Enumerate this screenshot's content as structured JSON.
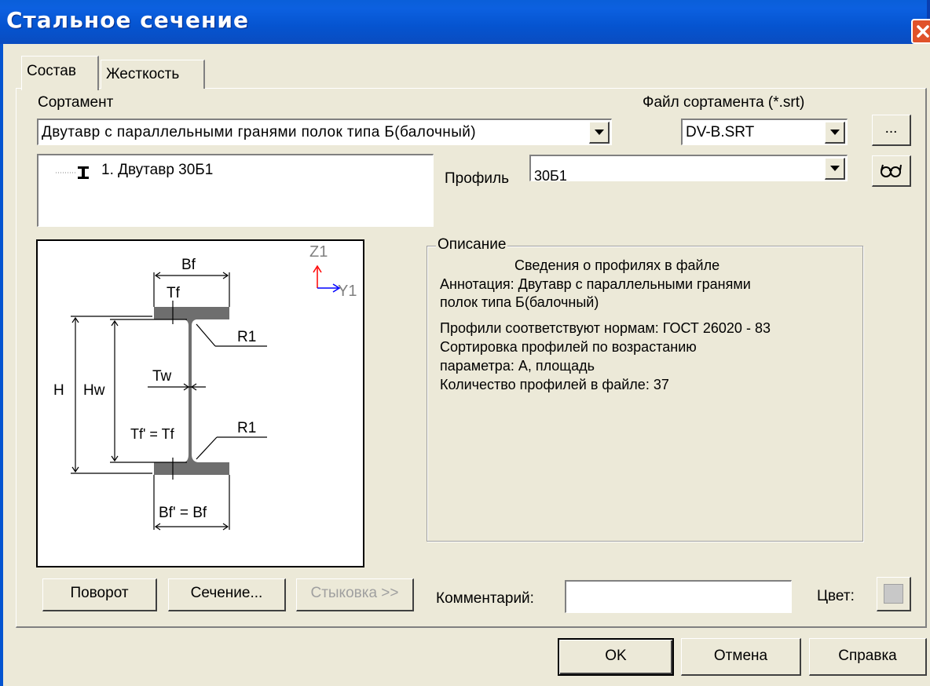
{
  "window": {
    "title": "Стальное сечение"
  },
  "tabs": [
    {
      "label": "Состав",
      "active": true
    },
    {
      "label": "Жесткость",
      "active": false
    }
  ],
  "assortment": {
    "label": "Сортамент",
    "value": "Двутавр с параллельными гранями полок типа Б(балочный)"
  },
  "assortment_file": {
    "label": "Файл сортамента (*.srt)",
    "value": "DV-B.SRT",
    "browse_label": "..."
  },
  "tree": {
    "items": [
      {
        "label": "1. Двутавр 30Б1",
        "icon": "i-beam-icon"
      }
    ]
  },
  "profile": {
    "label": "Профиль",
    "value": "30Б1"
  },
  "diagram": {
    "axis_z": "Z1",
    "axis_y": "Y1",
    "labels": {
      "bf": "Bf",
      "tf": "Tf",
      "r1_top": "R1",
      "h": "H",
      "hw": "Hw",
      "tw": "Tw",
      "tf2": "Tf' = Tf",
      "r1_bottom": "R1",
      "bf2": "Bf' = Bf"
    }
  },
  "description": {
    "title": "Описание",
    "lines": [
      "Сведения о профилях в файле",
      "Аннотация: Двутавр с параллельными гранями",
      "полок типа Б(балочный)",
      "Профили соответствуют нормам: ГОСТ 26020 - 83",
      "Сортировка профилей по возрастанию",
      "параметра: А, площадь",
      "Количество профилей в файле: 37"
    ]
  },
  "buttons": {
    "rotate": "Поворот",
    "section": "Сечение...",
    "joint": "Стыковка >>",
    "ok": "OK",
    "cancel": "Отмена",
    "help": "Справка"
  },
  "comment": {
    "label": "Комментарий:",
    "value": ""
  },
  "color": {
    "label": "Цвет:",
    "value": "#c8c8c8"
  }
}
